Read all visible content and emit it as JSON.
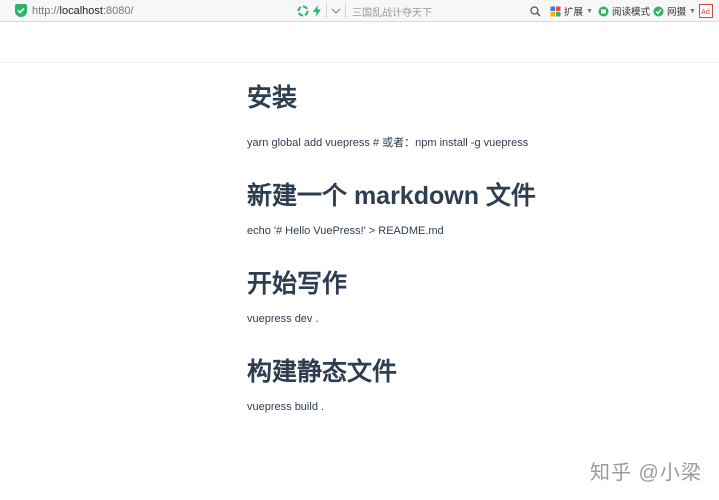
{
  "browser": {
    "url": {
      "protocol": "http://",
      "host": "localhost",
      "port": ":8080/"
    },
    "search_box_text": "三国乱战计夺天下",
    "toolbar": {
      "extensions_label": "扩展",
      "reader_mode_label": "阅读模式",
      "clip_label": "网摄"
    },
    "icons": [
      "shield-icon",
      "recycle-icon",
      "lightning-icon",
      "chevron-down-icon",
      "search-icon",
      "extensions-icon",
      "reader-mode-icon",
      "clip-icon",
      "pdf-icon"
    ],
    "colors": {
      "secure_green": "#2db36a",
      "text": "#2c3e50",
      "toolbar_bg": "#f7f7f7"
    }
  },
  "doc": {
    "sections": [
      {
        "heading": "安装",
        "code": "yarn global add vuepress # 或者：npm install -g vuepress"
      },
      {
        "heading": "新建一个 markdown 文件",
        "code": "echo '# Hello VuePress!' > README.md"
      },
      {
        "heading": "开始写作",
        "code": "vuepress dev ."
      },
      {
        "heading": "构建静态文件",
        "code": "vuepress build ."
      }
    ]
  },
  "watermark": "知乎 @小梁"
}
